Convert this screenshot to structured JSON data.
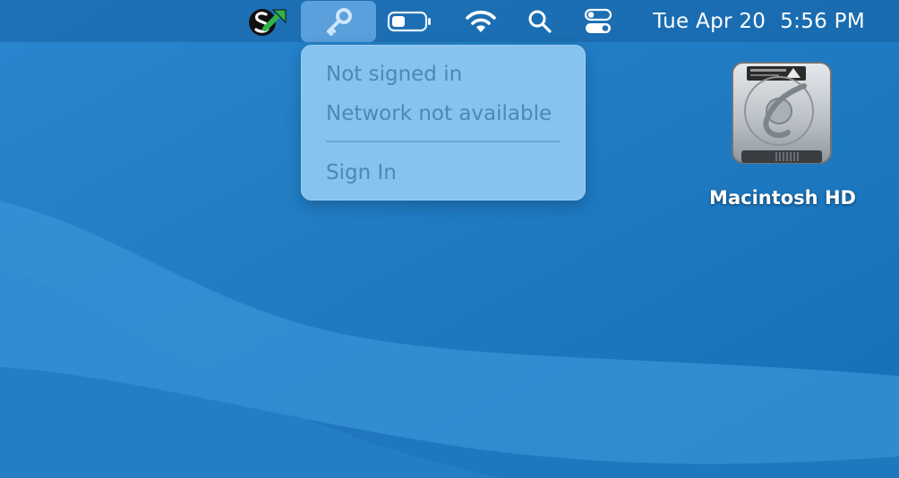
{
  "menubar": {
    "items": [
      {
        "icon": "app-s-arrow-icon"
      },
      {
        "icon": "key-icon",
        "active": true
      },
      {
        "icon": "battery-icon"
      },
      {
        "icon": "wifi-icon"
      },
      {
        "icon": "search-icon"
      },
      {
        "icon": "control-center-icon"
      }
    ],
    "date": "Tue Apr 20",
    "time": "5:56 PM"
  },
  "dropdown": {
    "status_line1": "Not signed in",
    "status_line2": "Network not available",
    "sign_in": "Sign In"
  },
  "desktop": {
    "disk_label": "Macintosh HD"
  },
  "colors": {
    "wallpaper": "#1f74be",
    "menu_bg": "#86c3ef",
    "menu_text_disabled": "#4f87b5"
  }
}
